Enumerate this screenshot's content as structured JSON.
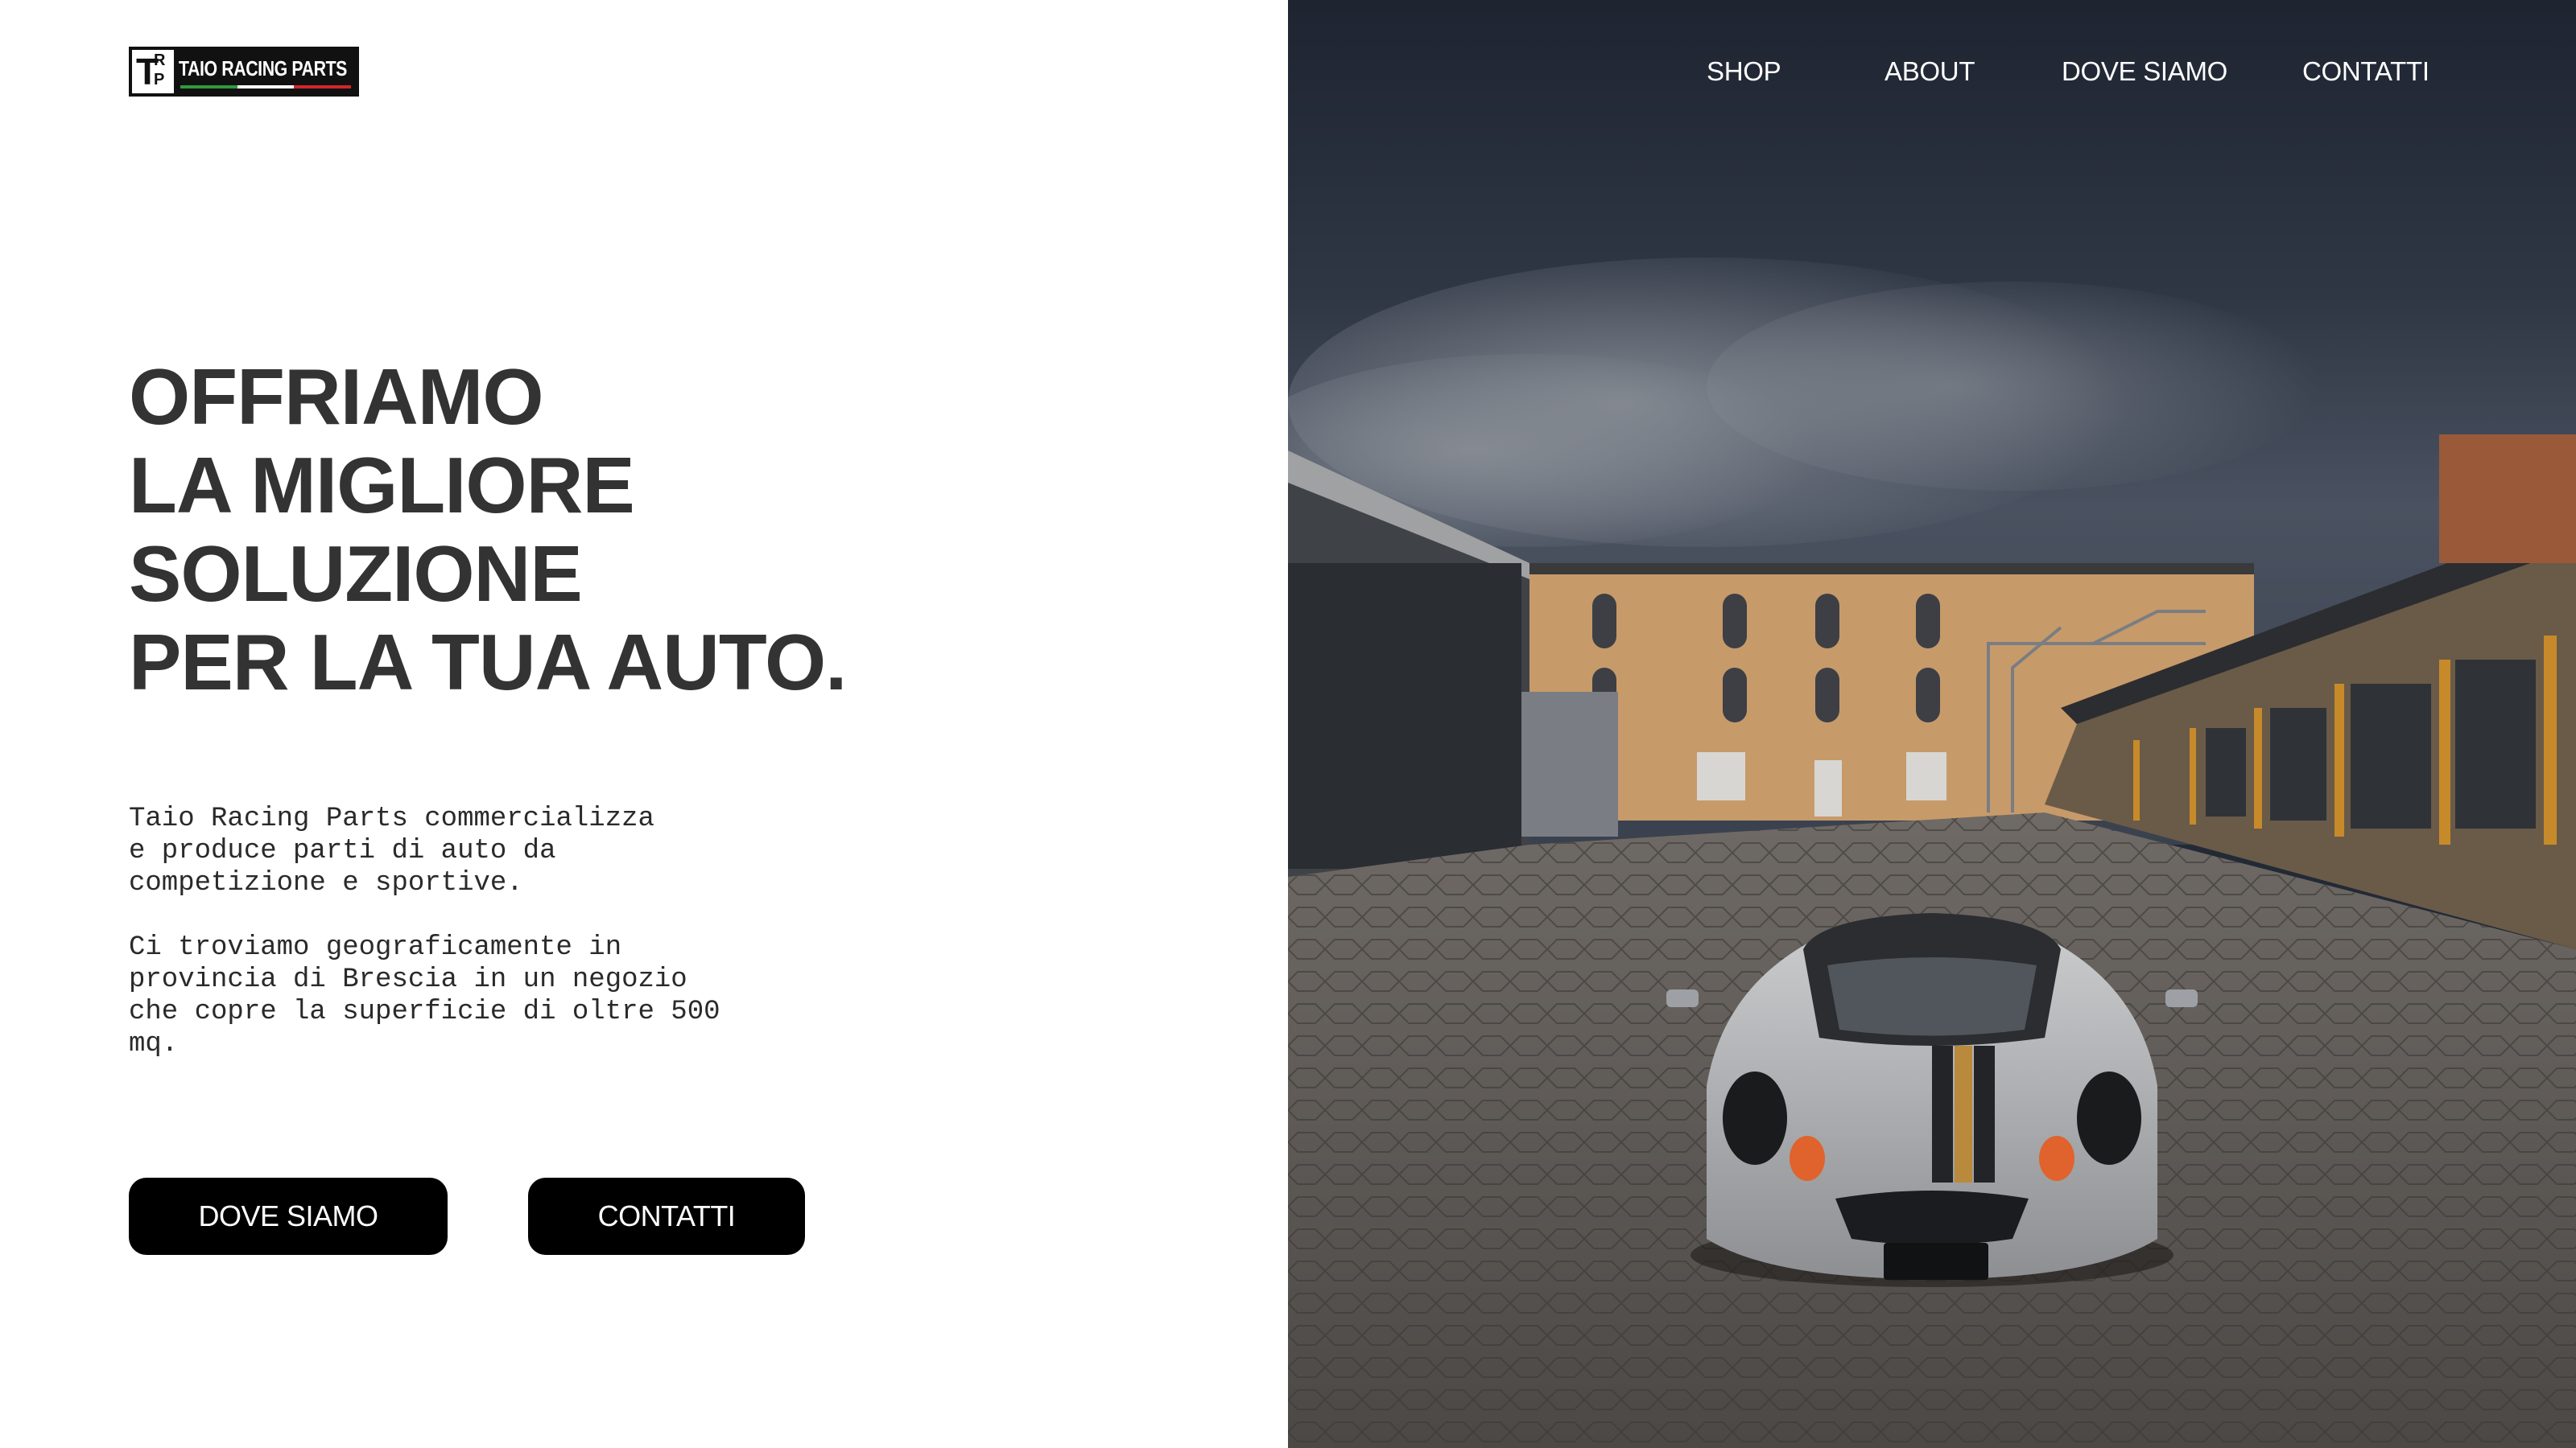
{
  "brand": {
    "logo_mark_t": "T",
    "logo_mark_r": "R",
    "logo_mark_p": "P",
    "name": "TAIO RACING PARTS",
    "flag_colors": [
      "#2e9a3e",
      "#ffffff",
      "#d3262b"
    ]
  },
  "nav": {
    "items": [
      {
        "label": "SHOP"
      },
      {
        "label": "ABOUT"
      },
      {
        "label": "DOVE SIAMO"
      },
      {
        "label": "CONTATTI"
      }
    ]
  },
  "hero": {
    "headline_lines": [
      "OFFRIAMO",
      "LA MIGLIORE",
      "SOLUZIONE",
      "PER LA TUA AUTO."
    ],
    "paragraph_1": "Taio Racing Parts commercializza\ne produce parti di auto da\ncompetizione e sportive.",
    "paragraph_2": "Ci troviamo geograficamente in\nprovincia di Brescia in un negozio\nche copre la superficie di oltre 500\nmq.",
    "buttons": {
      "dove_siamo": "DOVE SIAMO",
      "contatti": "CONTATTI"
    }
  },
  "colors": {
    "headline": "#333333",
    "button_bg": "#000000",
    "button_text": "#ffffff"
  }
}
